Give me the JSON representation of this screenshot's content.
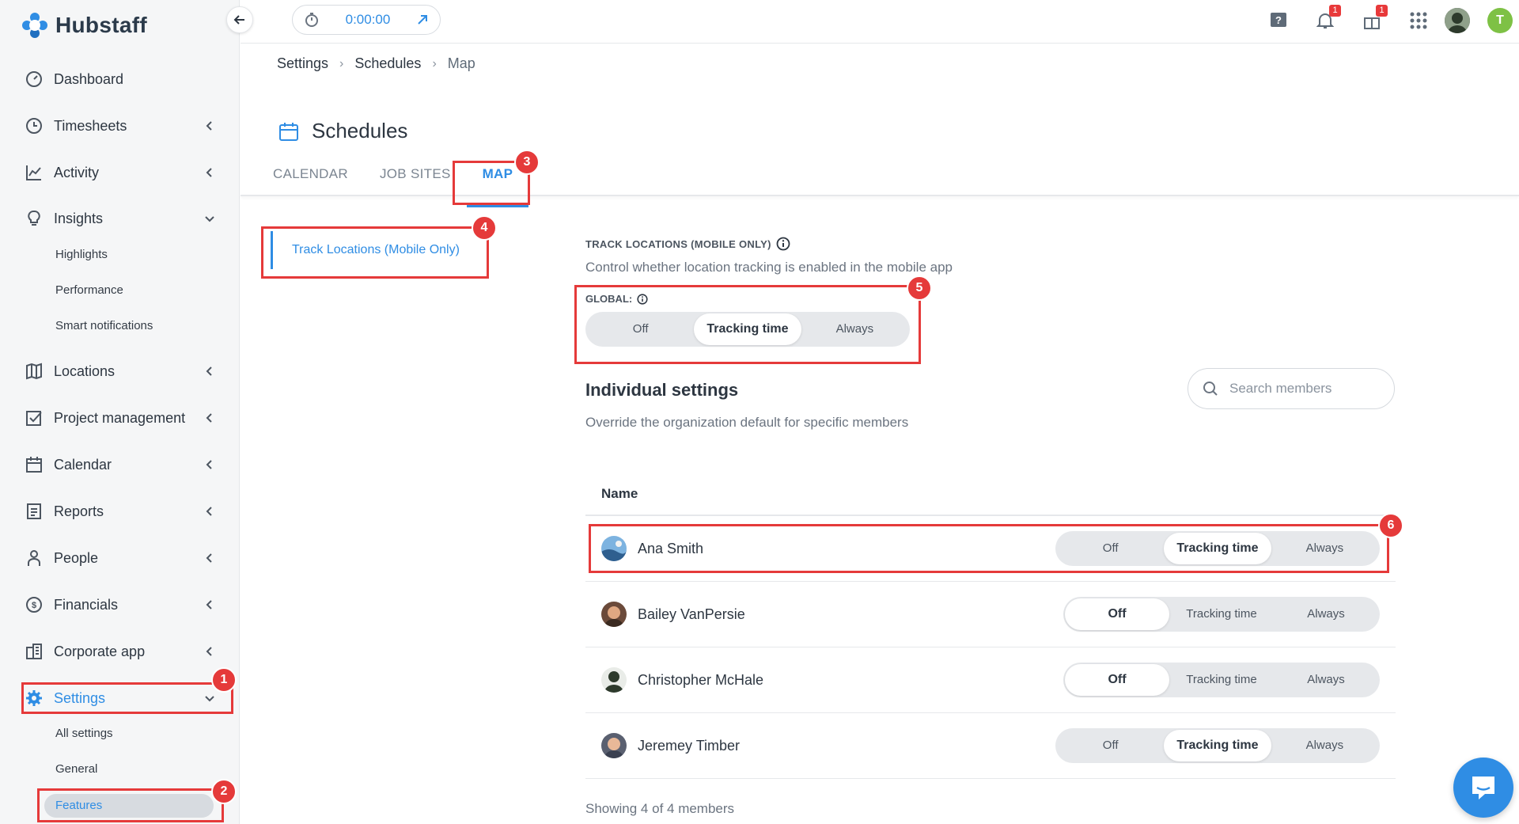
{
  "app": {
    "name": "Hubstaff"
  },
  "topbar": {
    "timer": "0:00:00",
    "notifications_badge": "1",
    "gifts_badge": "1",
    "user_initial": "T"
  },
  "sidebar": {
    "items": [
      {
        "label": "Dashboard",
        "icon": "dashboard-icon"
      },
      {
        "label": "Timesheets",
        "icon": "clock-icon"
      },
      {
        "label": "Activity",
        "icon": "activity-chart-icon"
      },
      {
        "label": "Insights",
        "icon": "lightbulb-icon"
      },
      {
        "label": "Locations",
        "icon": "map-icon"
      },
      {
        "label": "Project management",
        "icon": "checkbox-icon"
      },
      {
        "label": "Calendar",
        "icon": "calendar-icon"
      },
      {
        "label": "Reports",
        "icon": "report-icon"
      },
      {
        "label": "People",
        "icon": "person-icon"
      },
      {
        "label": "Financials",
        "icon": "dollar-icon"
      },
      {
        "label": "Corporate app",
        "icon": "building-icon"
      },
      {
        "label": "Settings",
        "icon": "gear-icon"
      }
    ],
    "insights_sub": [
      "Highlights",
      "Performance",
      "Smart notifications"
    ],
    "settings_sub": [
      "All settings",
      "General",
      "Features"
    ]
  },
  "breadcrumb": [
    "Settings",
    "Schedules",
    "Map"
  ],
  "page": {
    "title": "Schedules",
    "tabs": [
      "CALENDAR",
      "JOB SITES",
      "MAP"
    ]
  },
  "side_section": "Track Locations (Mobile Only)",
  "track": {
    "label": "TRACK LOCATIONS (MOBILE ONLY)",
    "desc": "Control whether location tracking is enabled in the mobile app",
    "global_label": "GLOBAL:",
    "options": [
      "Off",
      "Tracking time",
      "Always"
    ],
    "global_selected": "Tracking time"
  },
  "individual": {
    "title": "Individual settings",
    "desc": "Override the organization default for specific members",
    "search_placeholder": "Search members",
    "column_name": "Name",
    "members": [
      {
        "name": "Ana Smith",
        "setting": "Tracking time"
      },
      {
        "name": "Bailey VanPersie",
        "setting": "Off"
      },
      {
        "name": "Christopher McHale",
        "setting": "Off"
      },
      {
        "name": "Jeremey Timber",
        "setting": "Tracking time"
      }
    ],
    "showing": "Showing 4 of 4 members"
  },
  "annotations": [
    "1",
    "2",
    "3",
    "4",
    "5",
    "6"
  ],
  "colors": {
    "accent": "#2f8de4",
    "annotation": "#e53a3a",
    "user_avatar": "#7ec145"
  }
}
